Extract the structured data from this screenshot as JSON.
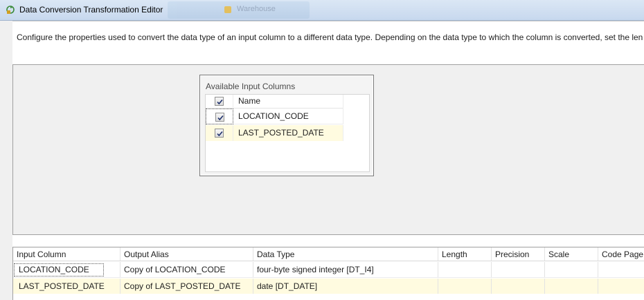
{
  "window": {
    "title": "Data Conversion Transformation Editor",
    "background_label": "Warehouse"
  },
  "description": "Configure the properties used to convert the data type of an input column to a different data type. Depending on the data type to which the column is converted, set the len",
  "available_input_columns": {
    "title": "Available Input Columns",
    "header": {
      "checked": true,
      "label": "Name"
    },
    "rows": [
      {
        "checked": true,
        "name": "LOCATION_CODE"
      },
      {
        "checked": true,
        "name": "LAST_POSTED_DATE"
      }
    ]
  },
  "conversion_grid": {
    "columns": [
      "Input Column",
      "Output Alias",
      "Data Type",
      "Length",
      "Precision",
      "Scale",
      "Code Page"
    ],
    "rows": [
      {
        "input_column": "LOCATION_CODE",
        "output_alias": "Copy of LOCATION_CODE",
        "data_type": "four-byte signed integer [DT_I4]",
        "length": "",
        "precision": "",
        "scale": "",
        "code_page": ""
      },
      {
        "input_column": "LAST_POSTED_DATE",
        "output_alias": "Copy of LAST_POSTED_DATE",
        "data_type": "date [DT_DATE]",
        "length": "",
        "precision": "",
        "scale": "",
        "code_page": ""
      }
    ]
  },
  "colors": {
    "title_bar": "#c7d8ee",
    "surface": "#f0f0f0",
    "selected_row": "#fffbe0"
  }
}
